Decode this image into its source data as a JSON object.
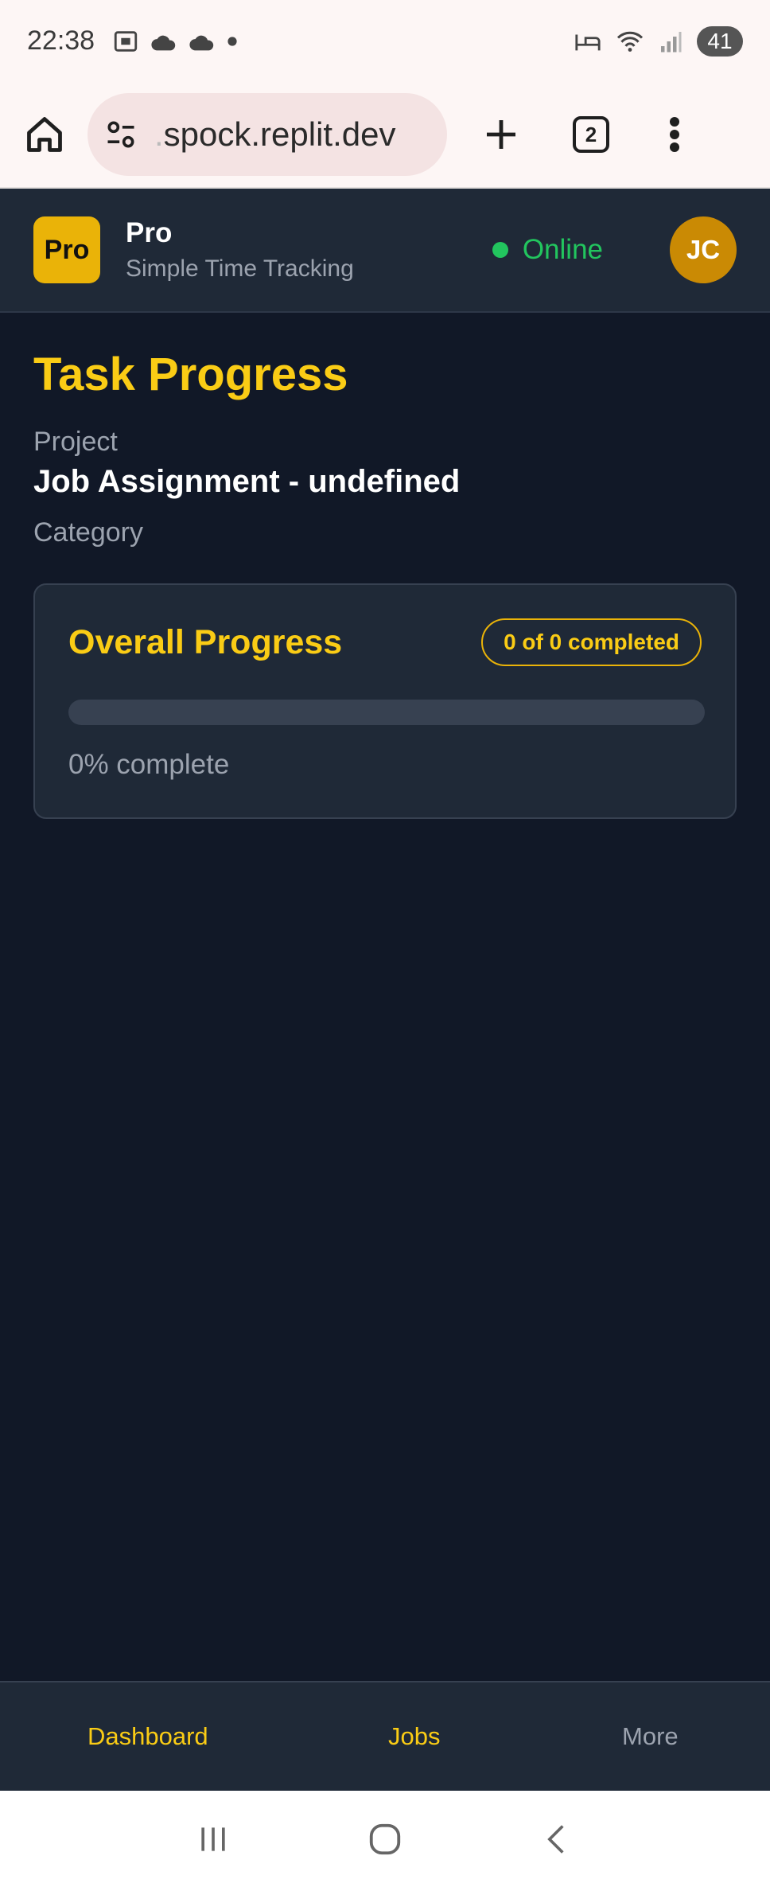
{
  "status_bar": {
    "time": "22:38",
    "battery": "41",
    "icons": [
      "screenshot-icon",
      "cloud-icon",
      "cloud-icon",
      "dot-icon",
      "bed-icon",
      "wifi-icon",
      "signal-icon"
    ]
  },
  "browser": {
    "url": "spock.replit.dev",
    "url_prefix": ".",
    "tab_count": "2"
  },
  "app_header": {
    "logo_text": "Pro",
    "brand_name": "Pro",
    "brand_subtitle": "Simple Time Tracking",
    "status_text": "Online",
    "avatar_initials": "JC",
    "colors": {
      "accent": "#facc15",
      "online": "#22c55e",
      "avatar": "#ca8a04"
    }
  },
  "main": {
    "title": "Task Progress",
    "project_label": "Project",
    "project_value": "Job Assignment - undefined",
    "category_label": "Category",
    "card": {
      "title": "Overall Progress",
      "badge": "0 of 0 completed",
      "progress_percent": 0,
      "progress_text": "0% complete"
    }
  },
  "bottom_nav": {
    "items": [
      {
        "label": "Dashboard"
      },
      {
        "label": "Jobs"
      },
      {
        "label": "More"
      }
    ]
  }
}
